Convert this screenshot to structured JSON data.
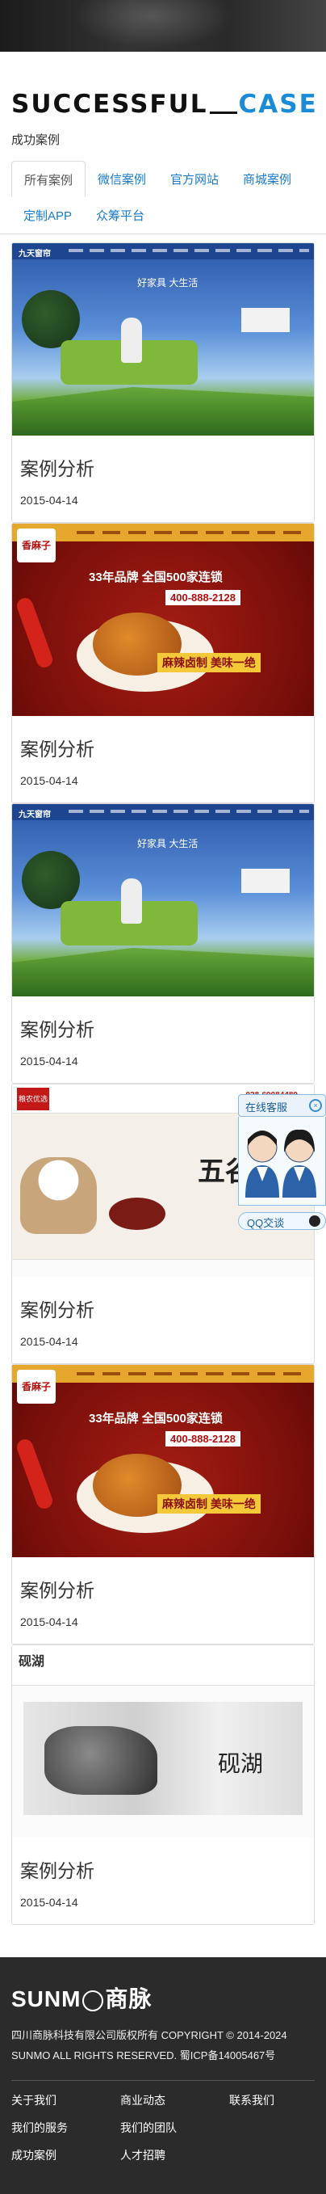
{
  "header": {
    "title_main": "SUCCESSFUL",
    "title_accent": "CASE",
    "subtitle": "成功案例"
  },
  "tabs": [
    {
      "label": "所有案例",
      "active": true
    },
    {
      "label": "微信案例"
    },
    {
      "label": "官方网站"
    },
    {
      "label": "商城案例"
    },
    {
      "label": "定制APP"
    },
    {
      "label": "众筹平台"
    }
  ],
  "cards": [
    {
      "title": "案例分析",
      "date": "2015-04-14",
      "thumb": "sofa"
    },
    {
      "title": "案例分析",
      "date": "2015-04-14",
      "thumb": "food"
    },
    {
      "title": "案例分析",
      "date": "2015-04-14",
      "thumb": "sofa"
    },
    {
      "title": "案例分析",
      "date": "2015-04-14",
      "thumb": "rice"
    },
    {
      "title": "案例分析",
      "date": "2015-04-14",
      "thumb": "food"
    },
    {
      "title": "案例分析",
      "date": "2015-04-14",
      "thumb": "ink"
    }
  ],
  "thumbs": {
    "sofa": {
      "logo": "九天窗帘",
      "slogan": "好家具 大生活"
    },
    "food": {
      "brand": "香麻子",
      "slogan": "33年品牌 全国500家连锁",
      "phone": "400-888-2128",
      "label": "麻辣卤制 美味一绝"
    },
    "rice": {
      "brand": "粮农优选",
      "phone": "028-69084489",
      "big": "五谷批发"
    },
    "ink": {
      "brand": "砚湖",
      "word": "砚湖"
    }
  },
  "service": {
    "title": "在线客服",
    "close": "×",
    "qq": "QQ交谈"
  },
  "footer": {
    "logo_left": "SUNM",
    "logo_right": "商脉",
    "copyright_line1": "四川商脉科技有限公司版权所有 COPYRIGHT © 2014-2024",
    "copyright_line2": "SUNMO ALL RIGHTS RESERVED. 蜀ICP备14005467号",
    "links": [
      "关于我们",
      "商业动态",
      "联系我们",
      "我们的服务",
      "我们的团队",
      "成功案例",
      "人才招聘"
    ]
  }
}
